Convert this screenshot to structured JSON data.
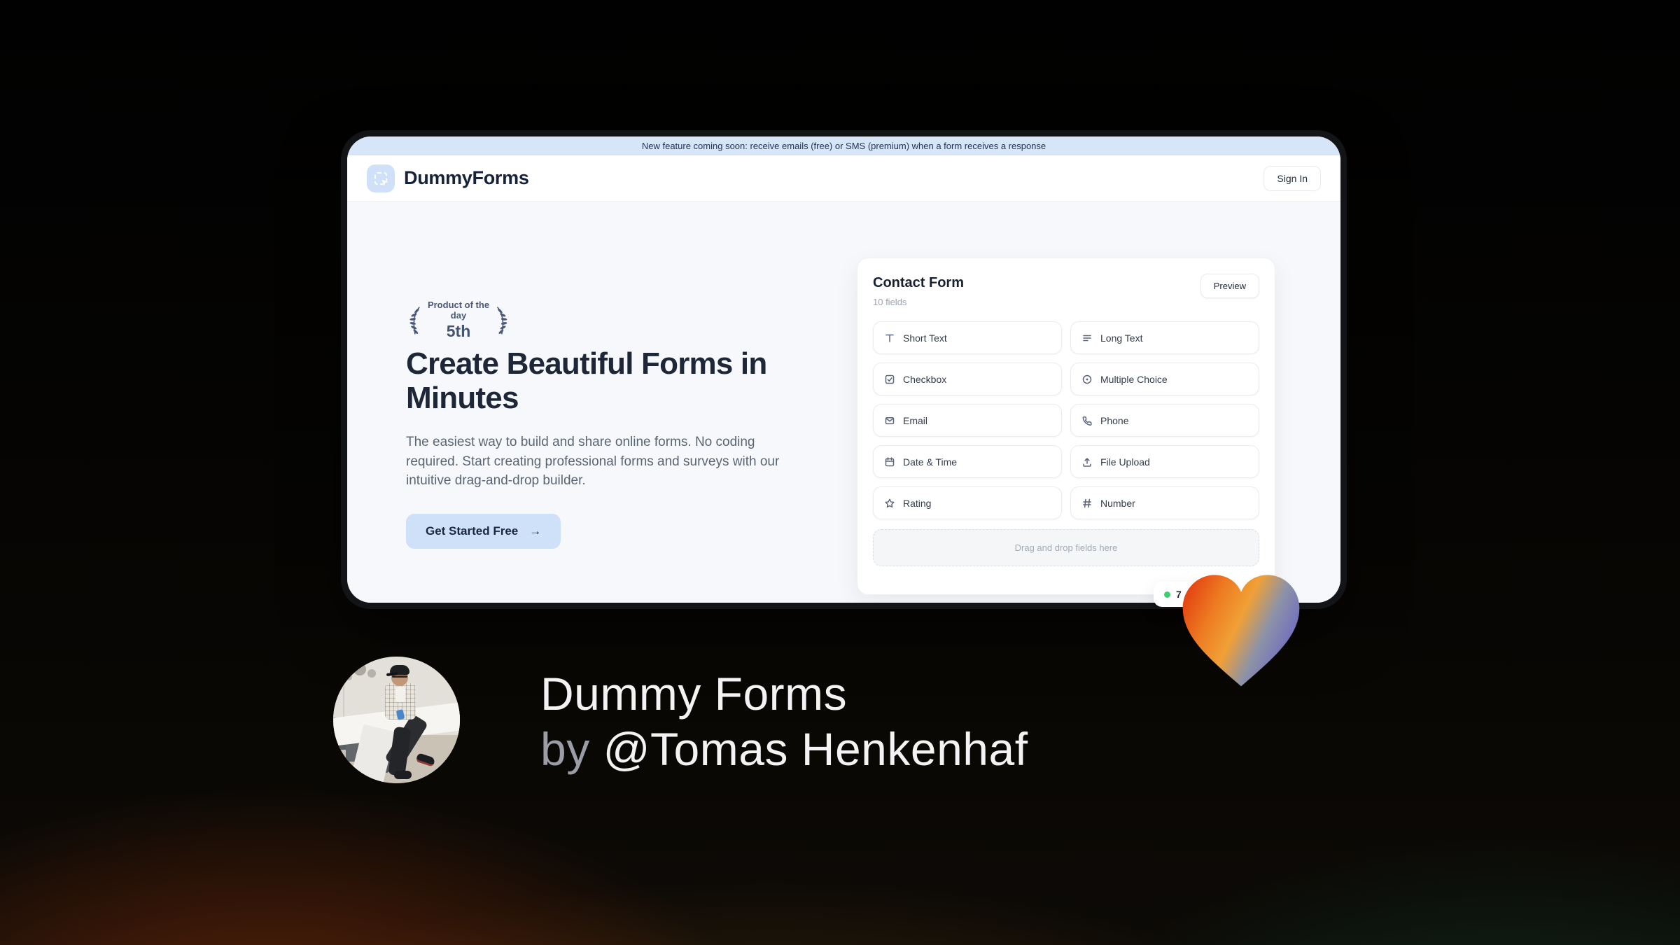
{
  "banner": {
    "text": "New feature coming soon: receive emails (free) or SMS (premium) when a form receives a response"
  },
  "header": {
    "brand": "DummyForms",
    "sign_in_label": "Sign In"
  },
  "hero": {
    "badge_label": "Product of the day",
    "badge_rank": "5th",
    "heading": "Create Beautiful Forms in Minutes",
    "subtext": "The easiest way to build and share online forms. No coding required. Start creating professional forms and surveys with our intuitive drag-and-drop builder.",
    "cta_label": "Get Started Free",
    "cta_arrow": "→"
  },
  "form_card": {
    "title": "Contact Form",
    "subtitle": "10 fields",
    "preview_label": "Preview",
    "fields": [
      {
        "label": "Short Text",
        "icon": "short-text-icon"
      },
      {
        "label": "Long Text",
        "icon": "long-text-icon"
      },
      {
        "label": "Checkbox",
        "icon": "checkbox-icon"
      },
      {
        "label": "Multiple Choice",
        "icon": "multiple-choice-icon"
      },
      {
        "label": "Email",
        "icon": "email-icon"
      },
      {
        "label": "Phone",
        "icon": "phone-icon"
      },
      {
        "label": "Date & Time",
        "icon": "calendar-icon"
      },
      {
        "label": "File Upload",
        "icon": "upload-icon"
      },
      {
        "label": "Rating",
        "icon": "star-icon"
      },
      {
        "label": "Number",
        "icon": "hash-icon"
      }
    ],
    "dropzone_text": "Drag and drop fields here",
    "live_badge_text": "7"
  },
  "credit": {
    "title": "Dummy Forms",
    "byline_prefix": "by",
    "byline_handle": "@Tomas Henkenhaf"
  },
  "colors": {
    "banner_bg": "#d7e5f8",
    "accent_blue": "#cfe1f9",
    "brand_navy": "#1b2740",
    "status_green": "#3fce6e",
    "heart_gradient": [
      "#e23a10",
      "#ee7c22",
      "#f0a036",
      "#8d93a6",
      "#7371bd"
    ]
  }
}
